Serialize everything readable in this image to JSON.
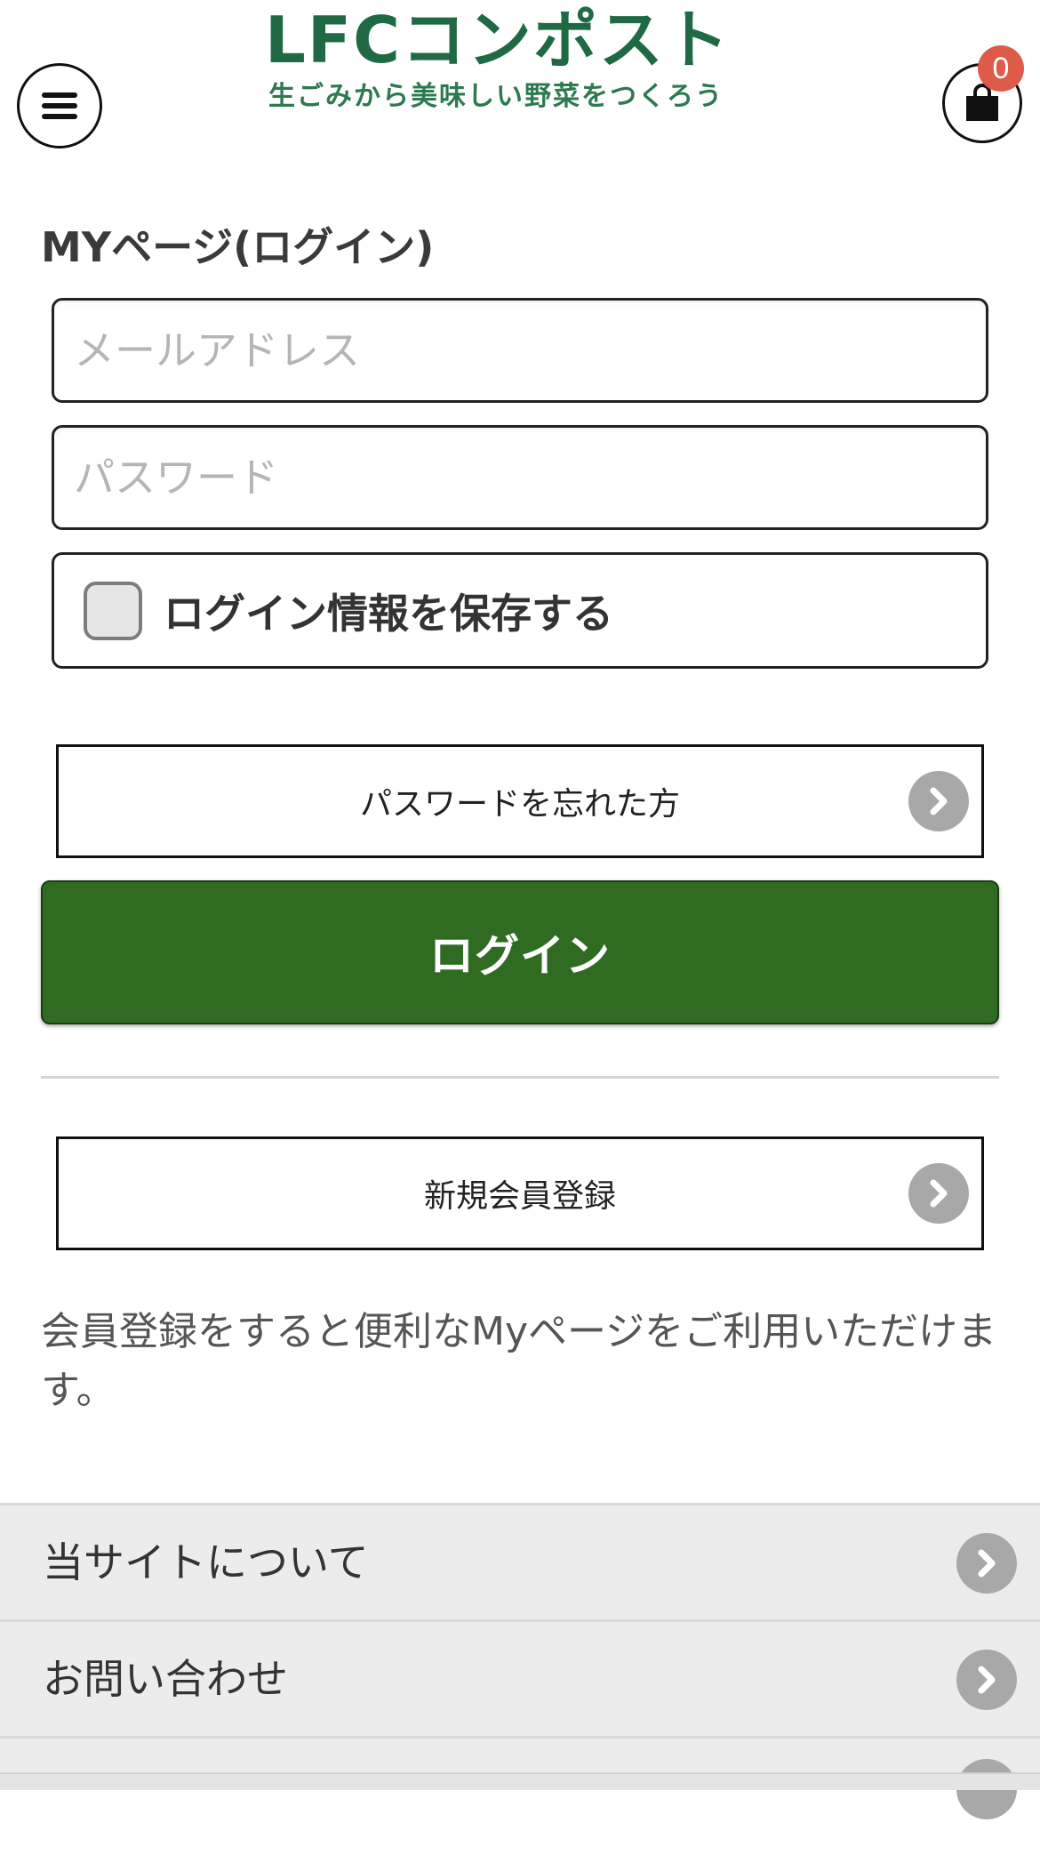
{
  "header": {
    "menu_icon": "hamburger-icon",
    "logo_title": "LFCコンポスト",
    "logo_tagline": "生ごみから美味しい野菜をつくろう",
    "cart_icon": "shopping-bag-icon",
    "cart_count": "0",
    "brand_color": "#1f6a45",
    "badge_color": "#e05a4a"
  },
  "login": {
    "title": "MYページ(ログイン)",
    "email_value": "",
    "email_placeholder": "メールアドレス",
    "password_value": "",
    "password_placeholder": "パスワード",
    "remember_label": "ログイン情報を保存する",
    "remember_checked": false,
    "forgot_password_label": "パスワードを忘れた方",
    "login_button_label": "ログイン",
    "login_button_color": "#306b22",
    "register_label": "新規会員登録",
    "arrow_icon": "chevron-right-circle-icon"
  },
  "info": {
    "text": "会員登録をすると便利なMyページをご利用いただけます。"
  },
  "footer_nav": {
    "items": [
      {
        "label": "当サイトについて"
      },
      {
        "label": "お問い合わせ"
      }
    ]
  }
}
